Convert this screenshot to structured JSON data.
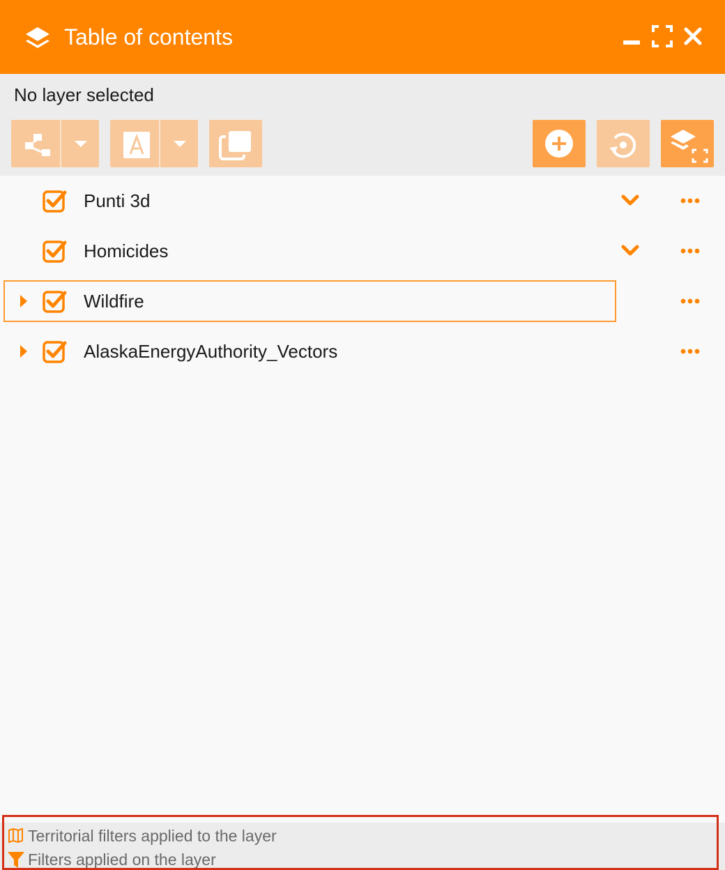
{
  "header": {
    "title": "Table of contents",
    "icons": {
      "title": "layers-icon",
      "minimize": "minimize-icon",
      "maximize": "maximize-icon",
      "close": "close-icon"
    }
  },
  "status": {
    "text": "No layer selected"
  },
  "toolbar": {
    "left": [
      {
        "name": "group-button",
        "icon": "hierarchy-icon",
        "has_dropdown": true
      },
      {
        "name": "style-button",
        "icon": "text-a-icon",
        "has_dropdown": true
      },
      {
        "name": "copy-button",
        "icon": "copy-icon",
        "has_dropdown": false
      }
    ],
    "right": [
      {
        "name": "add-layer-button",
        "icon": "plus-circle-icon"
      },
      {
        "name": "reset-button",
        "icon": "reset-icon"
      },
      {
        "name": "zoom-to-layer-button",
        "icon": "layers-fullscreen-icon"
      }
    ]
  },
  "layers": [
    {
      "name": "Punti 3d",
      "checked": true,
      "expandable": false,
      "has_chevron": true,
      "selected": false
    },
    {
      "name": "Homicides",
      "checked": true,
      "expandable": false,
      "has_chevron": true,
      "selected": false
    },
    {
      "name": "Wildfire",
      "checked": true,
      "expandable": true,
      "has_chevron": false,
      "selected": true
    },
    {
      "name": "AlaskaEnergyAuthority_Vectors",
      "checked": true,
      "expandable": true,
      "has_chevron": false,
      "selected": false
    }
  ],
  "legend": {
    "territorial": "Territorial filters applied to the layer",
    "filters": "Filters applied on the layer"
  },
  "colors": {
    "accent": "#ff8400",
    "accent_light": "#f8c89a",
    "accent_mid": "#fea24a",
    "panel_bg": "#ececec",
    "list_bg": "#f9f9f9",
    "highlight_border": "#d32f17"
  }
}
